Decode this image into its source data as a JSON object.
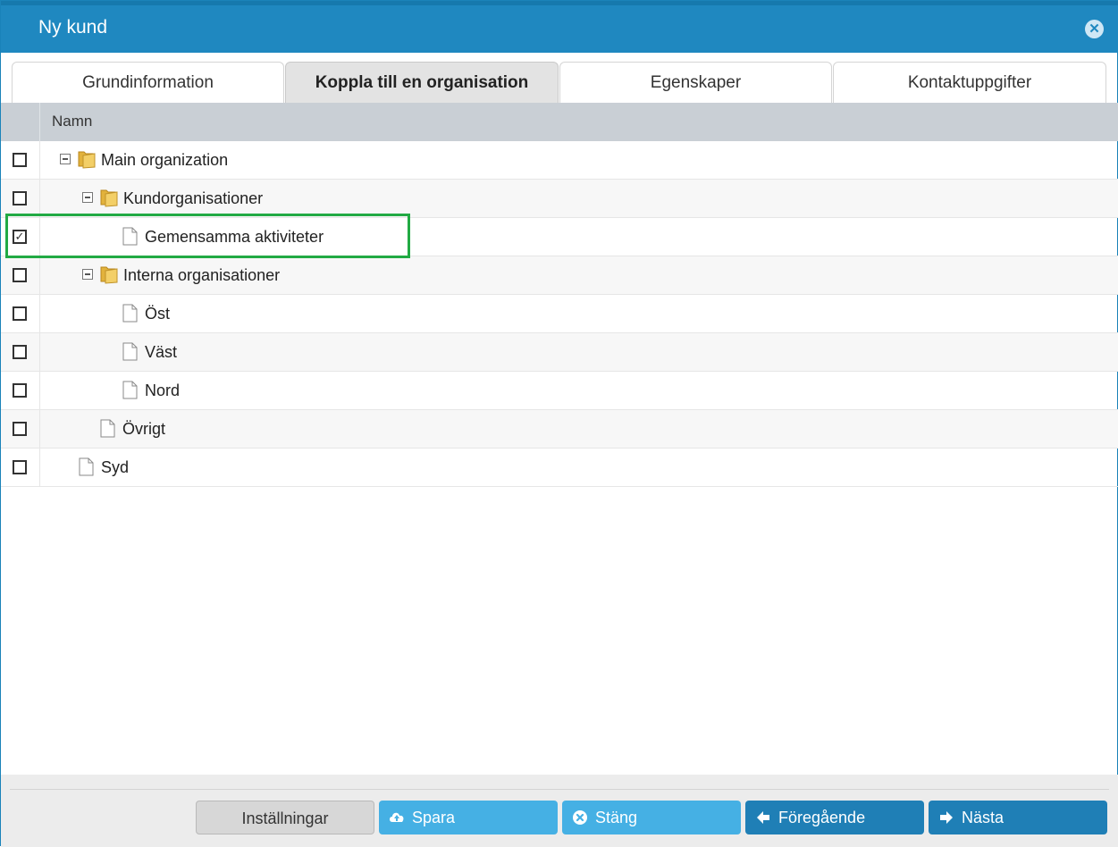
{
  "window": {
    "title": "Ny kund",
    "close_icon": "close-circle-icon"
  },
  "tabs": [
    {
      "label": "Grundinformation",
      "active": false
    },
    {
      "label": "Koppla till en organisation",
      "active": true
    },
    {
      "label": "Egenskaper",
      "active": false
    },
    {
      "label": "Kontaktuppgifter",
      "active": false
    }
  ],
  "grid": {
    "column_header": "Namn",
    "rows": [
      {
        "label": "Main organization",
        "checked": false,
        "icon": "folder-icon",
        "expandable": true
      },
      {
        "label": "Kundorganisationer",
        "checked": false,
        "icon": "folder-icon",
        "expandable": true
      },
      {
        "label": "Gemensamma aktiviteter",
        "checked": true,
        "icon": "document-icon",
        "expandable": false
      },
      {
        "label": "Interna organisationer",
        "checked": false,
        "icon": "folder-icon",
        "expandable": true
      },
      {
        "label": "Öst",
        "checked": false,
        "icon": "document-icon",
        "expandable": false
      },
      {
        "label": "Väst",
        "checked": false,
        "icon": "document-icon",
        "expandable": false
      },
      {
        "label": "Nord",
        "checked": false,
        "icon": "document-icon",
        "expandable": false
      },
      {
        "label": "Övrigt",
        "checked": false,
        "icon": "document-icon",
        "expandable": false
      },
      {
        "label": "Syd",
        "checked": false,
        "icon": "document-icon",
        "expandable": false
      }
    ]
  },
  "footer": {
    "settings_label": "Inställningar",
    "save_label": "Spara",
    "close_label": "Stäng",
    "previous_label": "Föregående",
    "next_label": "Nästa"
  },
  "colors": {
    "titlebar": "#1f88c0",
    "button_light": "#45b0e4",
    "button_dark": "#1f7fb6",
    "highlight": "#22aa44"
  }
}
